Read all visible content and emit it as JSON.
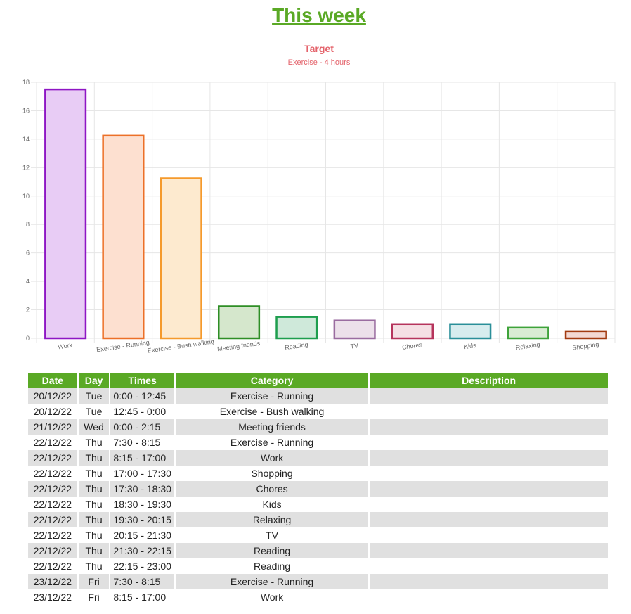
{
  "page": {
    "title": "This week"
  },
  "chart_data": {
    "type": "bar",
    "title": "Target",
    "subtitle": "Exercise - 4 hours",
    "categories": [
      "Work",
      "Exercise - Running",
      "Exercise - Bush walking",
      "Meeting friends",
      "Reading",
      "TV",
      "Chores",
      "Kids",
      "Relaxing",
      "Shopping"
    ],
    "values": [
      17.5,
      14.25,
      11.25,
      2.25,
      1.5,
      1.25,
      1,
      1,
      0.75,
      0.5
    ],
    "ylim": [
      0,
      18
    ],
    "yticks": [
      0,
      2,
      4,
      6,
      8,
      10,
      12,
      14,
      16,
      18
    ],
    "grid": true,
    "colors": {
      "stroke": [
        "#8e16c4",
        "#ec7028",
        "#f59a2c",
        "#2e8e25",
        "#1e9e4e",
        "#9a6ca0",
        "#b6345c",
        "#2a8f99",
        "#3ea33a",
        "#a23a10"
      ],
      "fill": [
        "#e8ccf5",
        "#fde0d0",
        "#fdeacf",
        "#d5e7cc",
        "#cfe9da",
        "#ece0ea",
        "#f5dfe4",
        "#d7ecee",
        "#d9ecd3",
        "#f3d8d2"
      ],
      "title": "#e4636b"
    }
  },
  "table": {
    "headers": [
      "Date",
      "Day",
      "Times",
      "Category",
      "Description"
    ],
    "rows": [
      [
        "20/12/22",
        "Tue",
        "0:00 - 12:45",
        "Exercise - Running",
        ""
      ],
      [
        "20/12/22",
        "Tue",
        "12:45 - 0:00",
        "Exercise - Bush walking",
        ""
      ],
      [
        "21/12/22",
        "Wed",
        "0:00 - 2:15",
        "Meeting friends",
        ""
      ],
      [
        "22/12/22",
        "Thu",
        "7:30 - 8:15",
        "Exercise - Running",
        ""
      ],
      [
        "22/12/22",
        "Thu",
        "8:15 - 17:00",
        "Work",
        ""
      ],
      [
        "22/12/22",
        "Thu",
        "17:00 - 17:30",
        "Shopping",
        ""
      ],
      [
        "22/12/22",
        "Thu",
        "17:30 - 18:30",
        "Chores",
        ""
      ],
      [
        "22/12/22",
        "Thu",
        "18:30 - 19:30",
        "Kids",
        ""
      ],
      [
        "22/12/22",
        "Thu",
        "19:30 - 20:15",
        "Relaxing",
        ""
      ],
      [
        "22/12/22",
        "Thu",
        "20:15 - 21:30",
        "TV",
        ""
      ],
      [
        "22/12/22",
        "Thu",
        "21:30 - 22:15",
        "Reading",
        ""
      ],
      [
        "22/12/22",
        "Thu",
        "22:15 - 23:00",
        "Reading",
        ""
      ],
      [
        "23/12/22",
        "Fri",
        "7:30 - 8:15",
        "Exercise - Running",
        ""
      ],
      [
        "23/12/22",
        "Fri",
        "8:15 - 17:00",
        "Work",
        ""
      ]
    ]
  }
}
